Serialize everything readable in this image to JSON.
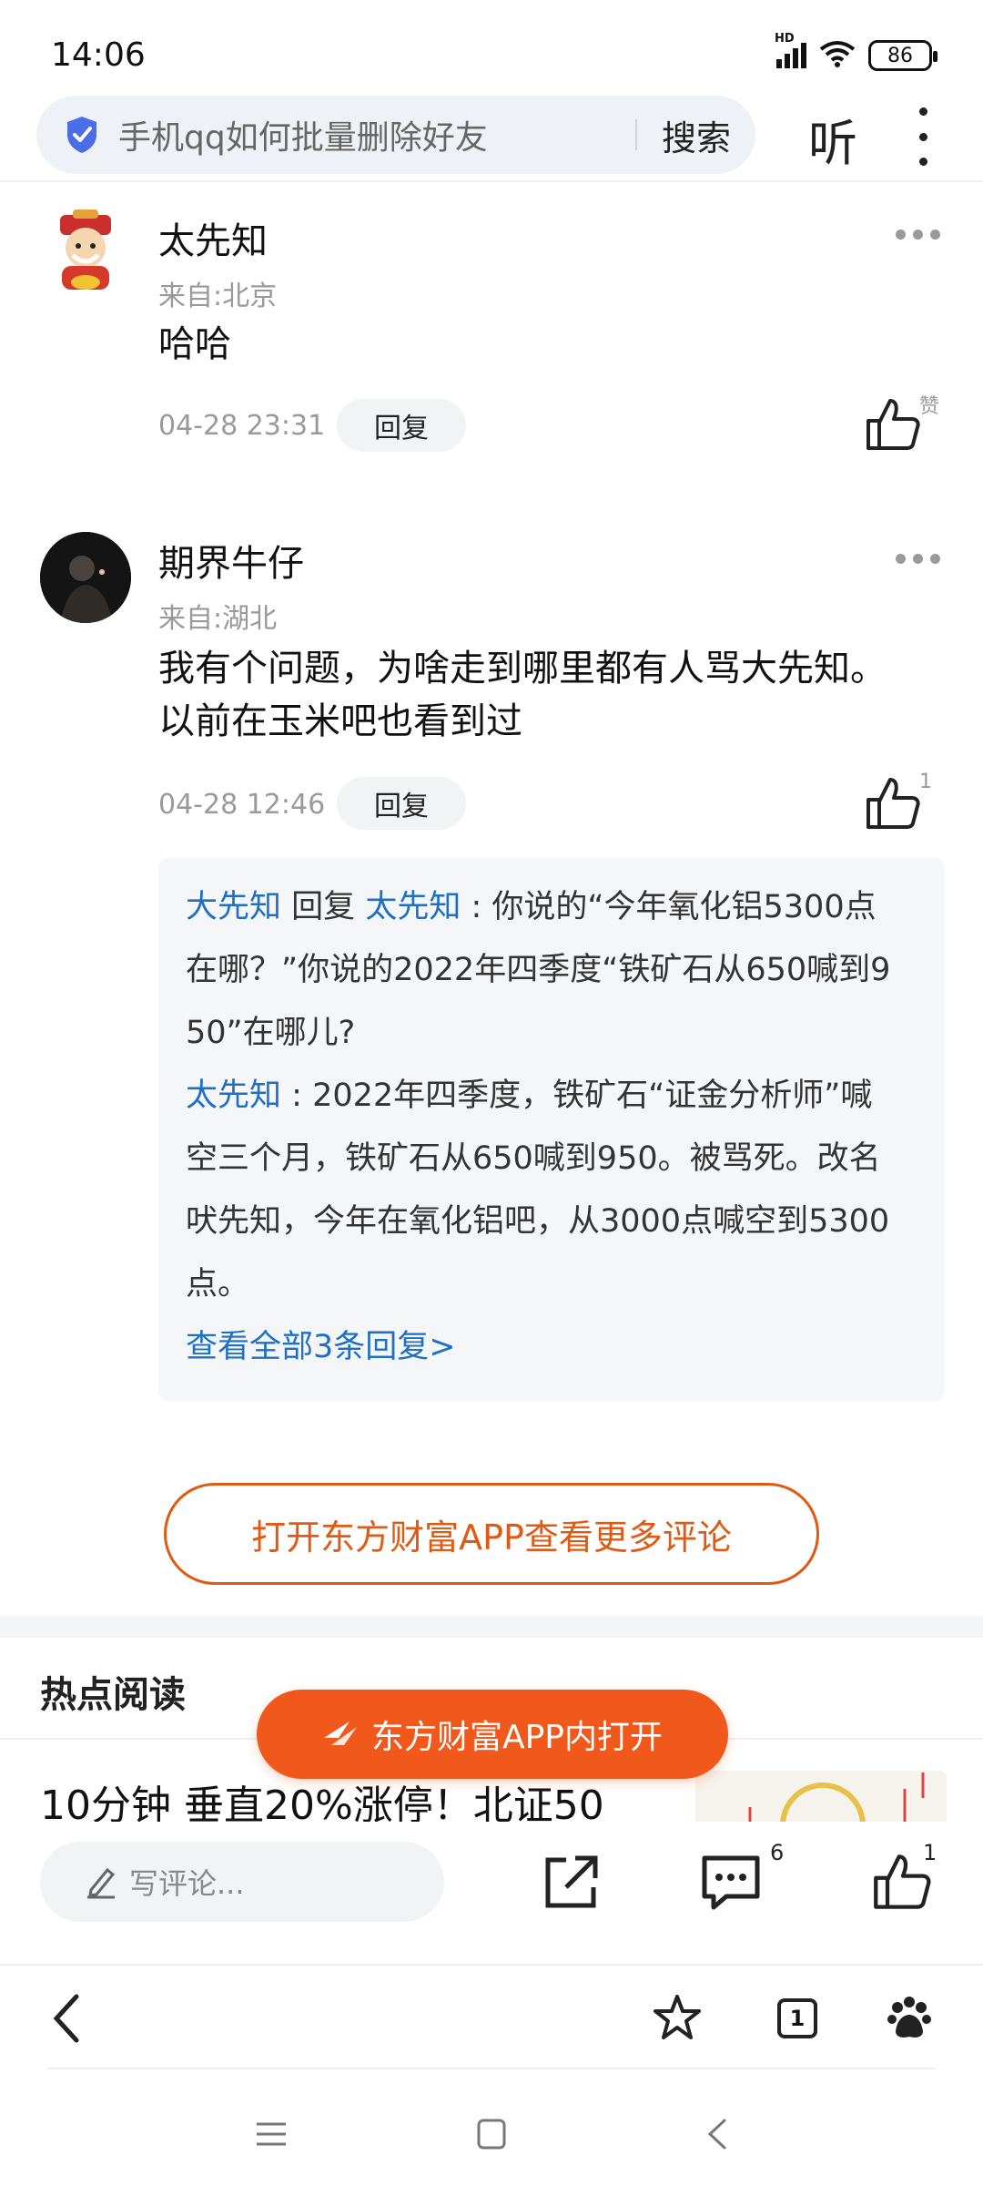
{
  "status_bar": {
    "time": "14:06",
    "network": "HD",
    "battery": "86"
  },
  "search": {
    "query": "手机qq如何批量删除好友",
    "button": "搜索",
    "listen": "听"
  },
  "comments": [
    {
      "name": "太先知",
      "from": "来自:北京",
      "text": "哈哈",
      "time": "04-28 23:31",
      "reply_label": "回复",
      "like_label": "赞"
    },
    {
      "name": "期界牛仔",
      "from": "来自:湖北",
      "text_line1": "我有个问题，为啥走到哪里都有人骂大先知。",
      "text_line2": "以前在玉米吧也看到过",
      "time": "04-28 12:46",
      "reply_label": "回复",
      "like_count": "1",
      "replies": {
        "r1_author": "大先知",
        "r1_mid": "回复",
        "r1_target": "太先知",
        "r1_line1": ": 你说的“今年氧化铝5300点",
        "r1_line2": "在哪？”你说的2022年四季度“铁矿石从650喊到9",
        "r1_line3": "50”在哪儿?",
        "r2_author": "太先知",
        "r2_line1": ": 2022年四季度，铁矿石“证金分析师”喊",
        "r2_line2": "空三个月，铁矿石从650喊到950。被骂死。改名",
        "r2_line3": "吠先知，今年在氧化铝吧，从3000点喊空到5300",
        "r2_line4": "点。",
        "view_all": "查看全部3条回复>"
      }
    }
  ],
  "open_app_more": "打开东方财富APP查看更多评论",
  "hot_reading": {
    "title": "热点阅读",
    "news_title": "10分钟 垂直20%涨停！北证50"
  },
  "float_button": "东方财富APP内打开",
  "action_bar": {
    "comment_placeholder": "写评论...",
    "comment_count": "6",
    "like_count": "1"
  },
  "browser": {
    "tab_count": "1"
  },
  "colors": {
    "accent_orange": "#f0581c",
    "link_blue": "#1f6fc5",
    "shield_blue": "#4b6ee8"
  }
}
